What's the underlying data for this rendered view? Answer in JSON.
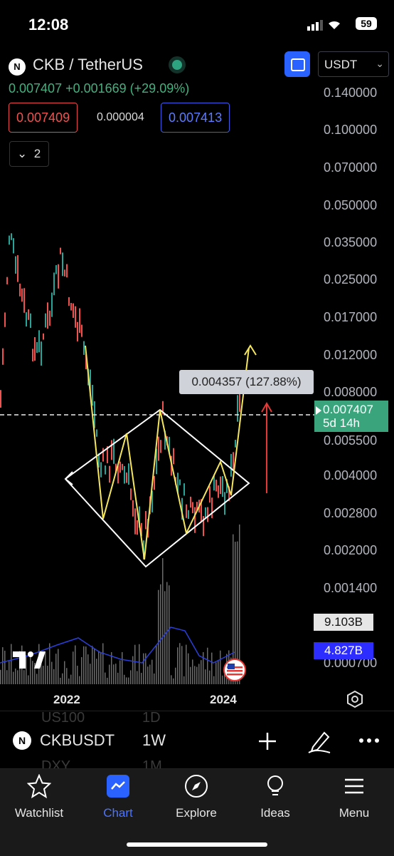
{
  "status": {
    "time": "12:08",
    "battery": "59"
  },
  "header": {
    "pair_title": "CKB / TetherUS",
    "currency": "USDT",
    "price_line": "0.007407 +0.001669 (+29.09%)",
    "bid": "0.007409",
    "spread": "0.000004",
    "ask": "0.007413",
    "indicators_count": "2"
  },
  "price_axis": [
    "0.140000",
    "0.100000",
    "0.070000",
    "0.050000",
    "0.035000",
    "0.025000",
    "0.017000",
    "0.012000",
    "0.008000",
    "0.005500",
    "0.004000",
    "0.002800",
    "0.002000",
    "0.001400",
    "0.000700"
  ],
  "measure_label": "0.004357 (127.88%)",
  "current_price": {
    "price": "0.007407",
    "countdown": "5d 14h"
  },
  "volume": {
    "value": "9.103B",
    "ma": "4.827B"
  },
  "time_axis": {
    "left": "2022",
    "right": "2024"
  },
  "chart": {
    "up_color": "#26a69a",
    "down_color": "#ef5350",
    "drawing_color": "#f5e65c"
  },
  "symbol_bar": {
    "symbol": "CKBUSDT",
    "timeframe": "1W",
    "ghost_1": "US100",
    "ghost_1_tf": "1D",
    "ghost_2": "DXY",
    "ghost_2_tf": "1M"
  },
  "tabs": [
    {
      "label": "Watchlist",
      "icon": "star-icon"
    },
    {
      "label": "Chart",
      "icon": "chart-icon"
    },
    {
      "label": "Explore",
      "icon": "compass-icon"
    },
    {
      "label": "Ideas",
      "icon": "lightbulb-icon"
    },
    {
      "label": "Menu",
      "icon": "menu-icon"
    }
  ]
}
